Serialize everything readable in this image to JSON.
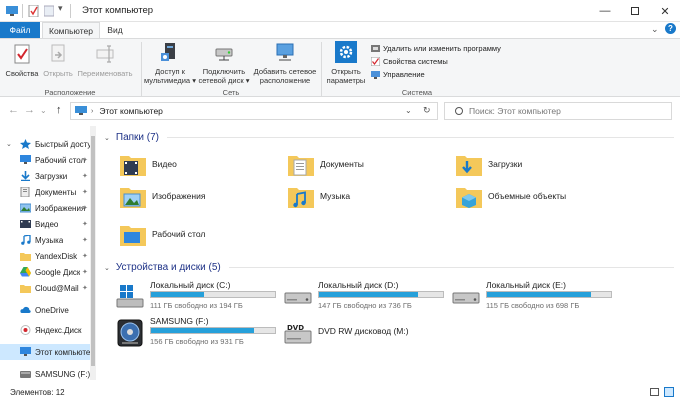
{
  "window": {
    "title": "Этот компьютер"
  },
  "tabs": {
    "file": "Файл",
    "computer": "Компьютер",
    "view": "Вид"
  },
  "ribbon": {
    "location": {
      "label": "Расположение",
      "properties": "Свойства",
      "open": "Открыть",
      "rename": "Переименовать"
    },
    "network": {
      "label": "Сеть",
      "media_1": "Доступ к",
      "media_2": "мультимедиа",
      "map_1": "Подключить",
      "map_2": "сетевой диск",
      "add_1": "Добавить сетевое",
      "add_2": "расположение"
    },
    "system": {
      "label": "Система",
      "open_1": "Открыть",
      "open_2": "параметры",
      "uninstall": "Удалить или изменить программу",
      "sysprops": "Свойства системы",
      "manage": "Управление"
    }
  },
  "address": {
    "path": "Этот компьютер",
    "search_placeholder": "Поиск: Этот компьютер"
  },
  "nav": {
    "quick": "Быстрый доступ",
    "items": [
      "Рабочий стол",
      "Загрузки",
      "Документы",
      "Изображения",
      "Видео",
      "Музыка",
      "YandexDisk",
      "Google Диск",
      "Cloud@Mail"
    ],
    "onedrive": "OneDrive",
    "yandex": "Яндекс.Диск",
    "thispc": "Этот компьютер",
    "samsung": "SAMSUNG (F:)"
  },
  "folders": {
    "header": "Папки (7)",
    "items": [
      "Видео",
      "Документы",
      "Загрузки",
      "Изображения",
      "Музыка",
      "Объемные объекты",
      "Рабочий стол"
    ]
  },
  "drives": {
    "header": "Устройства и диски (5)",
    "items": [
      {
        "name": "Локальный диск (C:)",
        "free": "111 ГБ свободно из 194 ГБ",
        "used_fraction": 0.43
      },
      {
        "name": "Локальный диск (D:)",
        "free": "147 ГБ свободно из 736 ГБ",
        "used_fraction": 0.8
      },
      {
        "name": "Локальный диск (E:)",
        "free": "115 ГБ свободно из 698 ГБ",
        "used_fraction": 0.84
      },
      {
        "name": "SAMSUNG (F:)",
        "free": "156 ГБ свободно из 931 ГБ",
        "used_fraction": 0.83
      },
      {
        "name": "DVD RW дисковод (M:)",
        "free": ""
      }
    ]
  },
  "status": {
    "count": "Элементов: 12"
  },
  "colors": {
    "accent": "#1979ca",
    "bar_fill": "#26a0da",
    "folder": "#f4c85a"
  }
}
